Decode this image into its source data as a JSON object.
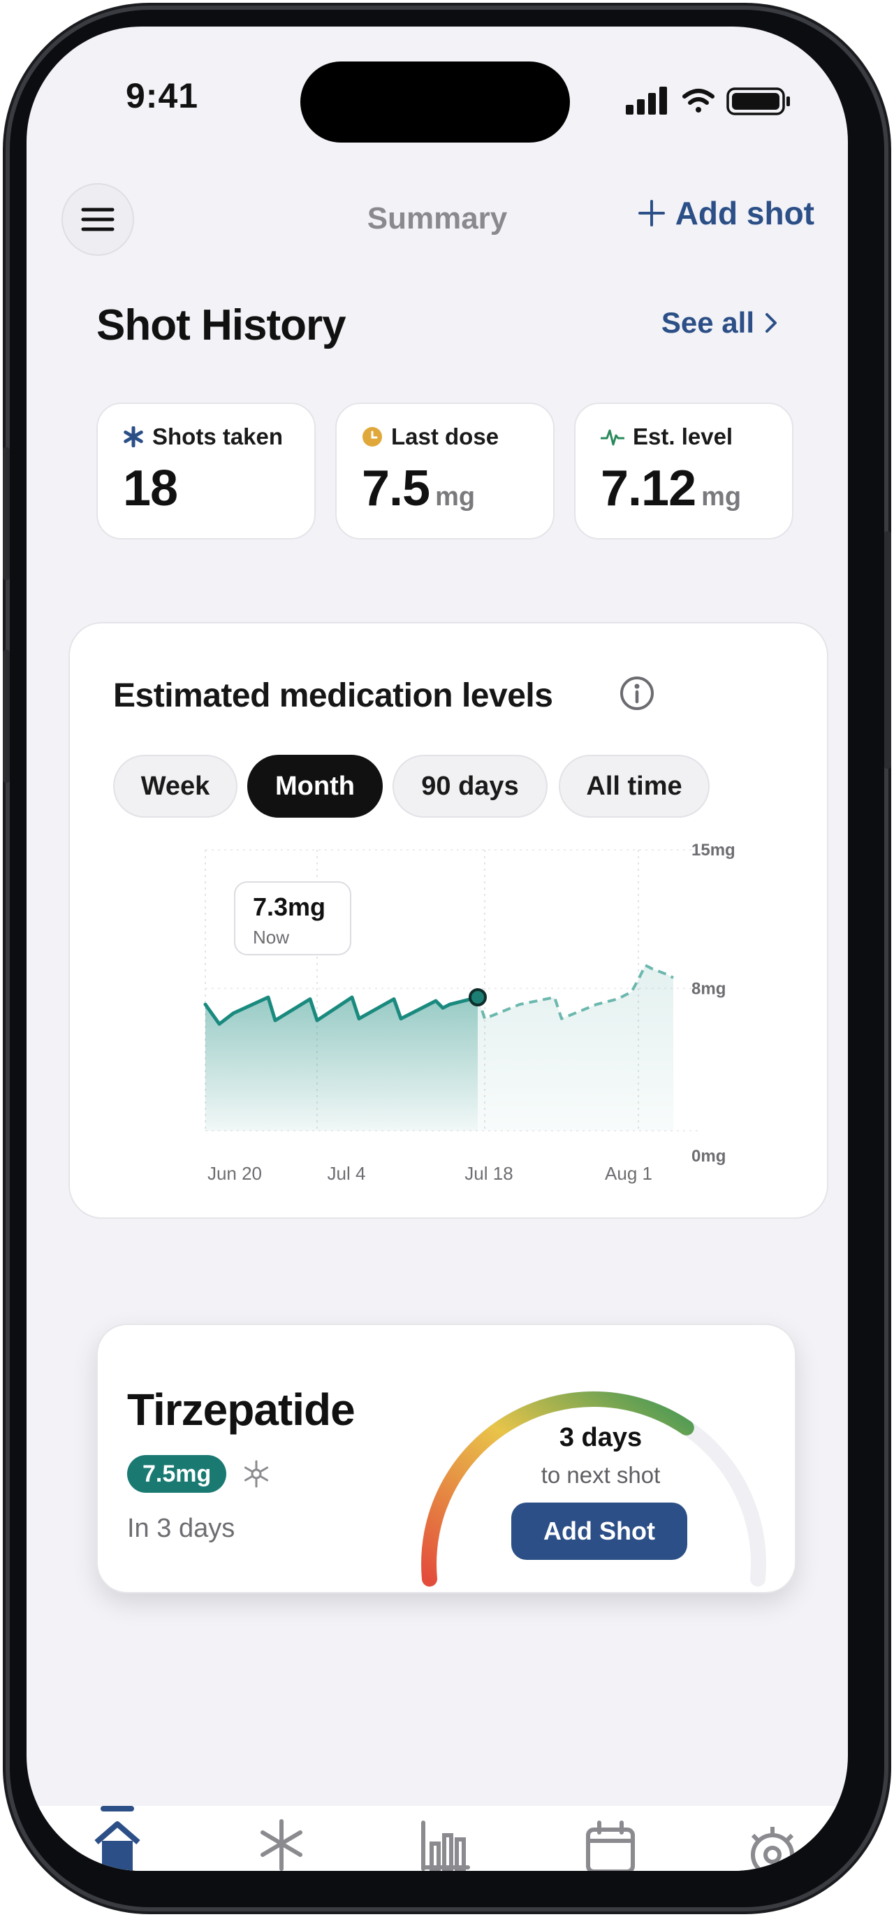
{
  "status_bar": {
    "time": "9:41"
  },
  "header": {
    "title": "Summary",
    "add_shot_label": "Add shot"
  },
  "shot_history": {
    "title": "Shot History",
    "see_all_label": "See all",
    "stats": [
      {
        "label": "Shots taken",
        "value": "18",
        "unit": "",
        "icon": "asterisk-icon"
      },
      {
        "label": "Last dose",
        "value": "7.5",
        "unit": "mg",
        "icon": "clock-icon"
      },
      {
        "label": "Est. level",
        "value": "7.12",
        "unit": "mg",
        "icon": "heartbeat-icon"
      }
    ]
  },
  "levels_card": {
    "title": "Estimated medication levels",
    "ranges": [
      {
        "label": "Week",
        "active": false
      },
      {
        "label": "Month",
        "active": true
      },
      {
        "label": "90 days",
        "active": false
      },
      {
        "label": "All time",
        "active": false
      }
    ],
    "tooltip": {
      "value": "7.3mg",
      "label": "Now"
    }
  },
  "chart_data": {
    "type": "area",
    "x_ticks": [
      "Jun 20",
      "Jul 4",
      "Jul 18",
      "Aug 1"
    ],
    "y_ticks": [
      "15mg",
      "8mg",
      "0mg"
    ],
    "ylim": [
      0,
      15
    ],
    "y_unit": "mg",
    "grid": true,
    "now_index": 14,
    "series": [
      {
        "x": [
          0,
          2,
          4,
          9,
          10,
          15,
          16,
          21,
          22,
          27,
          28,
          33,
          34,
          35,
          39,
          40,
          45,
          50,
          51,
          56,
          59,
          61,
          62,
          63,
          64,
          66,
          67
        ],
        "values": [
          7.1,
          6.0,
          6.6,
          7.5,
          6.2,
          7.4,
          6.2,
          7.5,
          6.3,
          7.4,
          6.3,
          7.3,
          6.9,
          7.1,
          7.5,
          6.3,
          7.1,
          7.5,
          6.3,
          7.1,
          7.4,
          7.8,
          8.5,
          9.3,
          9.1,
          8.8,
          8.6
        ],
        "projected_from_index": 14
      }
    ]
  },
  "medication": {
    "name": "Tirzepatide",
    "dose": "7.5mg",
    "next": "In 3 days",
    "gauge": {
      "days": "3 days",
      "subtitle": "to next shot",
      "button_label": "Add Shot",
      "progress": 0.68
    }
  },
  "colors": {
    "accent": "#2b4f86",
    "chart_teal": "#1a8a7e",
    "dose_teal": "#1a7a72",
    "gauge_start": "#e34e3c",
    "gauge_mid": "#e8c44a",
    "gauge_end": "#3f9656"
  },
  "tab_bar": {
    "items": [
      {
        "icon": "home-icon",
        "active": true
      },
      {
        "icon": "shot-icon",
        "active": false
      },
      {
        "icon": "bar-chart-icon",
        "active": false
      },
      {
        "icon": "calendar-icon",
        "active": false
      },
      {
        "icon": "gear-icon",
        "active": false
      }
    ]
  }
}
